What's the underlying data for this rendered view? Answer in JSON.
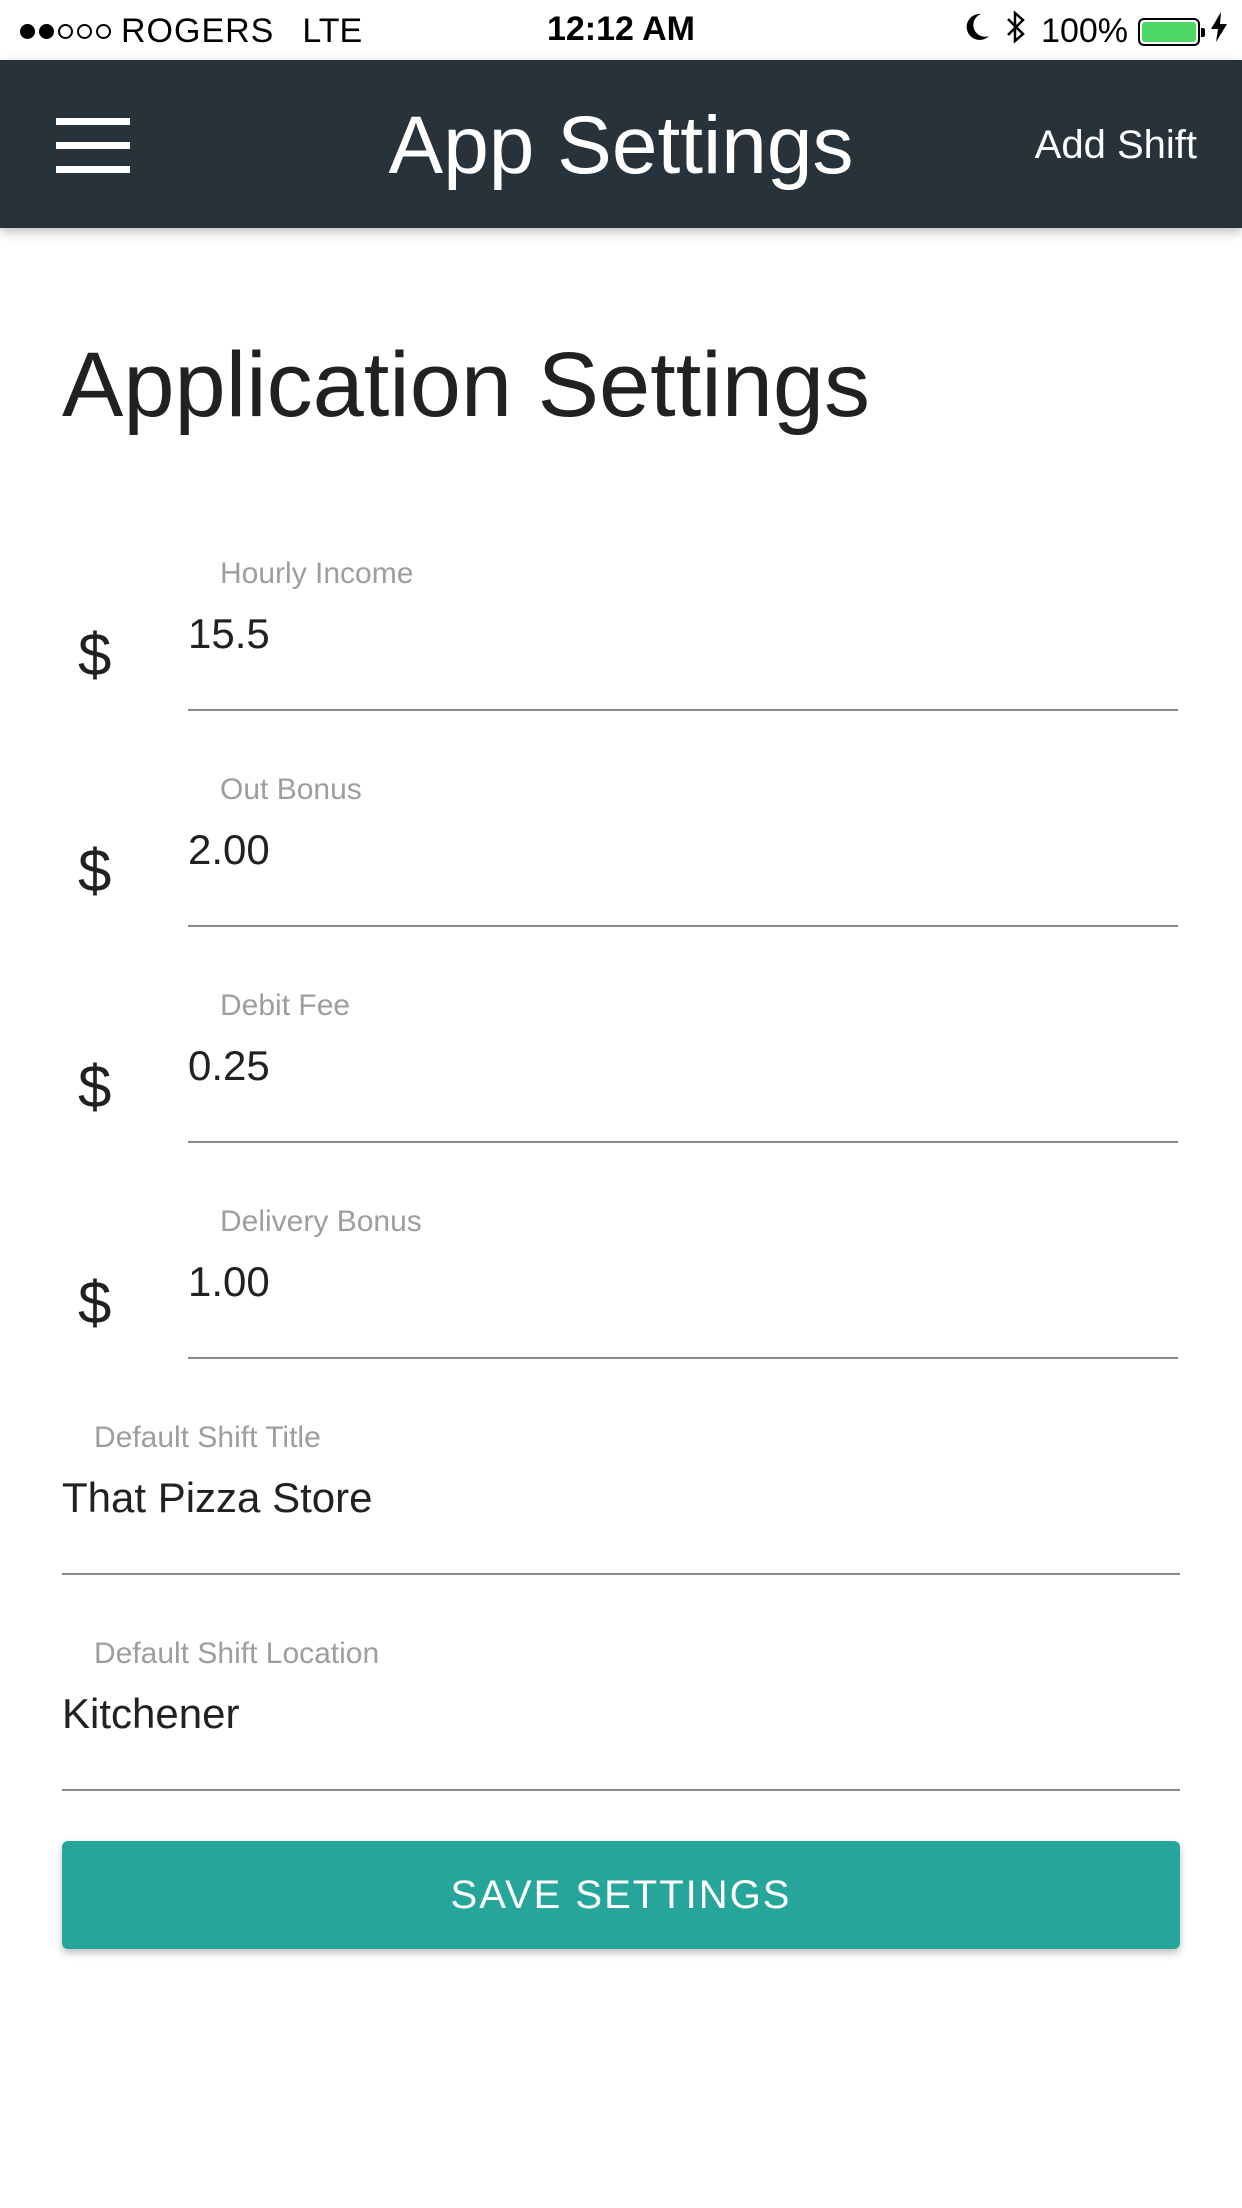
{
  "status_bar": {
    "carrier": "ROGERS",
    "network": "LTE",
    "time": "12:12 AM",
    "battery_percent": "100%",
    "signal_bars_filled": 2,
    "signal_bars_total": 5,
    "battery_color": "#4cd964"
  },
  "header": {
    "title": "App Settings",
    "menu_icon": "hamburger-menu-icon",
    "add_shift_label": "Add Shift",
    "background_color": "#27323a"
  },
  "main": {
    "page_title": "Application Settings",
    "currency_symbol": "$",
    "fields": [
      {
        "label": "Hourly Income",
        "value": "15.5"
      },
      {
        "label": "Out Bonus",
        "value": "2.00"
      },
      {
        "label": "Debit Fee",
        "value": "0.25"
      },
      {
        "label": "Delivery Bonus",
        "value": "1.00"
      },
      {
        "label": "Default Shift Title",
        "value": "That Pizza Store"
      },
      {
        "label": "Default Shift Location",
        "value": "Kitchener"
      }
    ],
    "save_button_label": "SAVE SETTINGS",
    "accent_color": "#26a69a"
  }
}
